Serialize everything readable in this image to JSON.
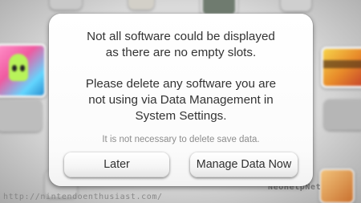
{
  "dialog": {
    "lines": [
      "Not all software could be displayed",
      "as there are no empty slots.",
      "Please delete any software you are",
      "not using via Data Management in",
      "System Settings."
    ],
    "note": "It is not necessary to delete save data.",
    "buttons": {
      "later": "Later",
      "manage": "Manage Data Now"
    }
  },
  "watermarks": {
    "left": "http://nintendoenthusiast.com/",
    "right": "NeoHelpNet"
  },
  "colors": {
    "dialog_background": "#ffffff",
    "text": "#333333",
    "note_text": "#8d8d8d",
    "button_background": "#f6f6f6"
  }
}
